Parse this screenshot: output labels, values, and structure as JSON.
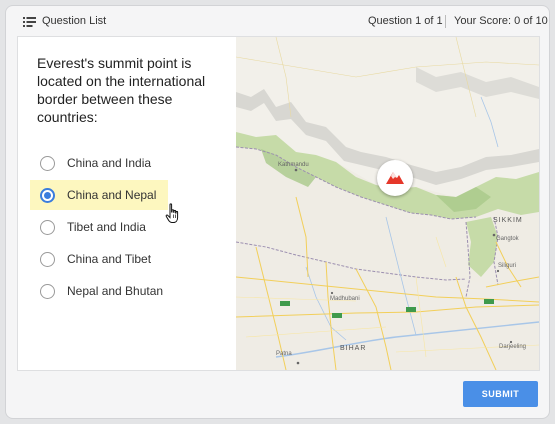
{
  "header": {
    "question_list_label": "Question List",
    "question_count": "Question 1 of 1",
    "score": "Your Score: 0 of 10"
  },
  "question": {
    "text": "Everest's summit point is located on the international border between these countries:"
  },
  "answers": [
    {
      "label": "China and India",
      "selected": false
    },
    {
      "label": "China and Nepal",
      "selected": true
    },
    {
      "label": "Tibet and India",
      "selected": false
    },
    {
      "label": "China and Tibet",
      "selected": false
    },
    {
      "label": "Nepal and Bhutan",
      "selected": false
    }
  ],
  "map": {
    "labels": {
      "kathmandu": "Kathmandu",
      "sikkim": "SIKKIM",
      "gangtok": "Gangtok",
      "madhubani": "Madhubani",
      "bihar": "BIHAR",
      "patna": "Patna",
      "siliguri": "Siliguri",
      "darjeeling": "Darjeeling"
    },
    "marker_icon": "mountain-peak-icon"
  },
  "footer": {
    "submit_label": "SUBMIT"
  },
  "colors": {
    "accent_blue": "#4a8fe7",
    "radio_selected": "#3b7ddd",
    "selected_highlight": "#fdf7bf",
    "marker_red": "#e5372a"
  }
}
